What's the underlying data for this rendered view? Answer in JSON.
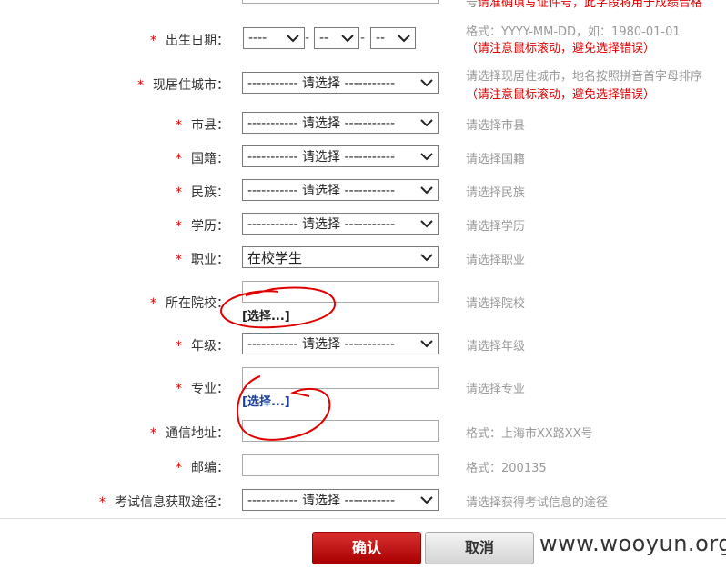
{
  "top_note": {
    "prefix": "号",
    "text": "请准确填写证件号，此字段将用于成绩合格"
  },
  "select_placeholder": "----------- 请选择 -----------",
  "birth": {
    "label": "出生日期：",
    "year": "----",
    "month": "--",
    "day": "--",
    "hint1": "格式：YYYY-MM-DD，如：1980-01-01",
    "hint2": "（请注意鼠标滚动，避免选择错误）"
  },
  "city": {
    "label": "现居住城市：",
    "hint1": "请选择现居住城市，地名按照拼音首字母排序",
    "hint2": "（请注意鼠标滚动，避免选择错误）"
  },
  "county": {
    "label": "市县：",
    "hint": "请选择市县"
  },
  "nationality": {
    "label": "国籍：",
    "hint": "请选择国籍"
  },
  "ethnicity": {
    "label": "民族：",
    "hint": "请选择民族"
  },
  "education": {
    "label": "学历：",
    "hint": "请选择学历"
  },
  "occupation": {
    "label": "职业：",
    "value": "在校学生",
    "hint": "请选择职业"
  },
  "school": {
    "label": "所在院校：",
    "choose": "[选择...]",
    "hint": "请选择院校"
  },
  "grade": {
    "label": "年级：",
    "hint": "请选择年级"
  },
  "major": {
    "label": "专业：",
    "choose": "[选择...]",
    "hint": "请选择专业"
  },
  "address": {
    "label": "通信地址：",
    "hint": "格式：上海市XX路XX号"
  },
  "postcode": {
    "label": "邮编：",
    "hint": "格式：200135"
  },
  "source": {
    "label": "考试信息获取途径：",
    "hint": "请选择获得考试信息的途径"
  },
  "required_mark": "*",
  "buttons": {
    "confirm": "确认",
    "cancel": "取消"
  },
  "watermark": "www.wooyun.org",
  "colors": {
    "required": "#e00000",
    "hint": "#999999",
    "confirm_bg": "#c01818",
    "link_blue": "#1a3f9a",
    "annotation": "#e00000"
  }
}
